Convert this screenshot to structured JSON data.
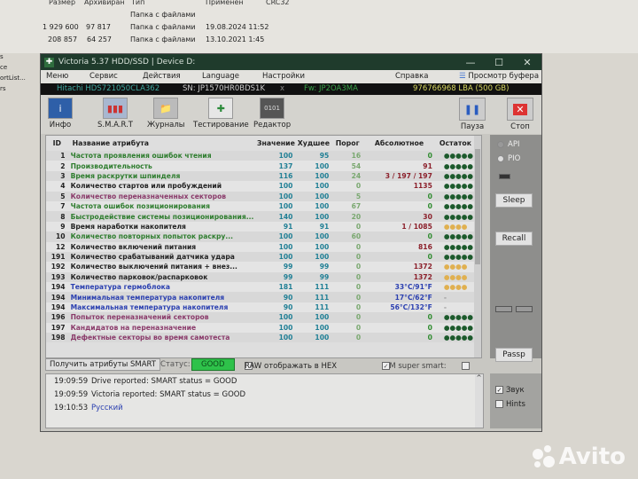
{
  "background_explorer": {
    "headers": [
      "Размер",
      "Архивиран",
      "Тип",
      "Применен",
      "CRC32"
    ],
    "rows": [
      {
        "size": "",
        "packed": "",
        "type": "Папка с файлами",
        "modified": ""
      },
      {
        "size": "1 929 600",
        "packed": "97 817",
        "type": "Папка с файлами",
        "modified": "19.08.2024 11:52"
      },
      {
        "size": "208 857",
        "packed": "64 257",
        "type": "Папка с файлами",
        "modified": "13.10.2021 1:45"
      }
    ],
    "left_items": [
      "s",
      "ce",
      "ortList...",
      "rs"
    ]
  },
  "window": {
    "title": "Victoria 5.37 HDD/SSD | Device D:",
    "controls": [
      "—",
      "☐",
      "✕"
    ],
    "menu": [
      "Меню",
      "Сервис",
      "Действия",
      "Language",
      "Настройки",
      "Справка",
      "Просмотр буфера"
    ],
    "drive": {
      "model": "Hitachi HDS721050CLA362",
      "serial": "SN: JP1570HR0BDS1K",
      "x": "x",
      "fw": "Fw: JP2OA3MA",
      "lba": "976766968 LBA (500 GB)"
    },
    "toolbar": [
      {
        "label": "Инфо",
        "icon": "info-icon"
      },
      {
        "label": "S.M.A.R.T",
        "icon": "smart-icon"
      },
      {
        "label": "Журналы",
        "icon": "logs-icon"
      },
      {
        "label": "Тестирование",
        "icon": "test-icon"
      },
      {
        "label": "Редактор",
        "icon": "editor-icon"
      },
      {
        "label": "Пауза",
        "icon": "pause-icon"
      },
      {
        "label": "Стоп",
        "icon": "stop-icon"
      }
    ]
  },
  "smart": {
    "columns": [
      "ID",
      "Название атрибута",
      "Значение",
      "Худшее",
      "Порог",
      "Абсолютное",
      "Остаток"
    ],
    "rows": [
      {
        "id": "1",
        "name": "Частота проявления ошибок чтения",
        "value": "100",
        "worst": "95",
        "thr": "16",
        "raw": "0",
        "rest": "●●●●●",
        "color": "#2e7d2e",
        "rawcolor": "#2e8b2e",
        "restcolor": "#1c5a2c"
      },
      {
        "id": "2",
        "name": "Производительность",
        "value": "137",
        "worst": "100",
        "thr": "54",
        "raw": "91",
        "rest": "●●●●●",
        "color": "#2e7d2e",
        "rawcolor": "#8b1f2a",
        "restcolor": "#1c5a2c"
      },
      {
        "id": "3",
        "name": "Время раскрутки шпинделя",
        "value": "116",
        "worst": "100",
        "thr": "24",
        "raw": "3 / 197 / 197",
        "rest": "●●●●●",
        "color": "#2e7d2e",
        "rawcolor": "#8b1f2a",
        "restcolor": "#1c5a2c"
      },
      {
        "id": "4",
        "name": "Количество стартов или пробуждений",
        "value": "100",
        "worst": "100",
        "thr": "0",
        "raw": "1135",
        "rest": "●●●●●",
        "color": "#222",
        "rawcolor": "#8b1f2a",
        "restcolor": "#1c5a2c"
      },
      {
        "id": "5",
        "name": "Количество переназначенных секторов",
        "value": "100",
        "worst": "100",
        "thr": "5",
        "raw": "0",
        "rest": "●●●●●",
        "color": "#8a3a6a",
        "rawcolor": "#2e8b2e",
        "restcolor": "#1c5a2c"
      },
      {
        "id": "7",
        "name": "Частота ошибок позиционирования",
        "value": "100",
        "worst": "100",
        "thr": "67",
        "raw": "0",
        "rest": "●●●●●",
        "color": "#2e7d2e",
        "rawcolor": "#2e8b2e",
        "restcolor": "#1c5a2c"
      },
      {
        "id": "8",
        "name": "Быстродействие системы позиционирования...",
        "value": "140",
        "worst": "100",
        "thr": "20",
        "raw": "30",
        "rest": "●●●●●",
        "color": "#2e7d2e",
        "rawcolor": "#8b1f2a",
        "restcolor": "#1c5a2c"
      },
      {
        "id": "9",
        "name": "Время наработки накопителя",
        "value": "91",
        "worst": "91",
        "thr": "0",
        "raw": "1 / 1085",
        "rest": "●●●●",
        "color": "#222",
        "rawcolor": "#8b1f2a",
        "restcolor": "#e0b050"
      },
      {
        "id": "10",
        "name": "Количество повторных попыток раскру...",
        "value": "100",
        "worst": "100",
        "thr": "60",
        "raw": "0",
        "rest": "●●●●●",
        "color": "#2e7d2e",
        "rawcolor": "#2e8b2e",
        "restcolor": "#1c5a2c"
      },
      {
        "id": "12",
        "name": "Количество включений питания",
        "value": "100",
        "worst": "100",
        "thr": "0",
        "raw": "816",
        "rest": "●●●●●",
        "color": "#222",
        "rawcolor": "#8b1f2a",
        "restcolor": "#1c5a2c"
      },
      {
        "id": "191",
        "name": "Количество срабатываний датчика удара",
        "value": "100",
        "worst": "100",
        "thr": "0",
        "raw": "0",
        "rest": "●●●●●",
        "color": "#222",
        "rawcolor": "#2e8b2e",
        "restcolor": "#1c5a2c"
      },
      {
        "id": "192",
        "name": "Количество выключений питания + внез...",
        "value": "99",
        "worst": "99",
        "thr": "0",
        "raw": "1372",
        "rest": "●●●●",
        "color": "#222",
        "rawcolor": "#8b1f2a",
        "restcolor": "#e0b050"
      },
      {
        "id": "193",
        "name": "Количество парковок/распарковок",
        "value": "99",
        "worst": "99",
        "thr": "0",
        "raw": "1372",
        "rest": "●●●●",
        "color": "#222",
        "rawcolor": "#8b1f2a",
        "restcolor": "#e0b050"
      },
      {
        "id": "194",
        "name": "Температура гермоблока",
        "value": "181",
        "worst": "111",
        "thr": "0",
        "raw": "33°C/91°F",
        "rest": "●●●●",
        "color": "#2a3fb0",
        "rawcolor": "#2a3fb0",
        "restcolor": "#e0b050"
      },
      {
        "id": "194",
        "name": "Минимальная температура накопителя",
        "value": "90",
        "worst": "111",
        "thr": "0",
        "raw": "17°C/62°F",
        "rest": "-",
        "color": "#2a3fb0",
        "rawcolor": "#2a3fb0",
        "restcolor": "#999"
      },
      {
        "id": "194",
        "name": "Максимальная температура накопителя",
        "value": "90",
        "worst": "111",
        "thr": "0",
        "raw": "56°C/132°F",
        "rest": "-",
        "color": "#2a3fb0",
        "rawcolor": "#2a3fb0",
        "restcolor": "#999"
      },
      {
        "id": "196",
        "name": "Попыток переназначений секторов",
        "value": "100",
        "worst": "100",
        "thr": "0",
        "raw": "0",
        "rest": "●●●●●",
        "color": "#8a3a6a",
        "rawcolor": "#2e8b2e",
        "restcolor": "#1c5a2c"
      },
      {
        "id": "197",
        "name": "Кандидатов на переназначение",
        "value": "100",
        "worst": "100",
        "thr": "0",
        "raw": "0",
        "rest": "●●●●●",
        "color": "#8a3a6a",
        "rawcolor": "#2e8b2e",
        "restcolor": "#1c5a2c"
      },
      {
        "id": "198",
        "name": "Дефектные секторы во время самотеста",
        "value": "100",
        "worst": "100",
        "thr": "0",
        "raw": "0",
        "rest": "●●●●●",
        "color": "#8a3a6a",
        "rawcolor": "#2e8b2e",
        "restcolor": "#1c5a2c"
      }
    ]
  },
  "right_panel": {
    "api": "API",
    "pio": "PIO",
    "api_selected": true,
    "sleep": "Sleep",
    "recall": "Recall",
    "passp": "Passp"
  },
  "status_bar": {
    "get_smart": "Получить атрибуты SMART",
    "status_label": "Статус:",
    "status_value": "GOOD",
    "status_color": "#2ec24a",
    "raw_hex": "RAW отображать в HEX",
    "raw_hex_checked": false,
    "ibm": "IBM super smart:",
    "ibm_checked": true
  },
  "log": [
    {
      "time": "19:09:59",
      "text": "Drive reported: SMART status = GOOD",
      "color": "#222"
    },
    {
      "time": "19:09:59",
      "text": "Victoria reported: SMART status = GOOD",
      "color": "#222"
    },
    {
      "time": "19:10:53",
      "text": "Русский",
      "color": "#2a3fb0"
    }
  ],
  "options": {
    "sound": "Звук",
    "sound_checked": true,
    "hints": "Hints",
    "hints_checked": false
  },
  "watermark": "Avito"
}
